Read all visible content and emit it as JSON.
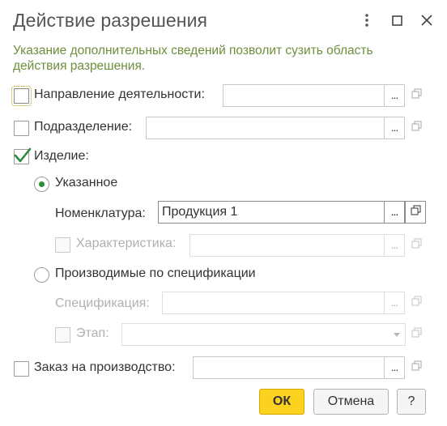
{
  "window": {
    "title": "Действие разрешения",
    "icons": {
      "more": "more-vertical-icon",
      "maximize": "maximize-icon",
      "close": "close-icon"
    }
  },
  "hint": "Указание дополнительных сведений позволит сузить область действия разрешения.",
  "fields": {
    "direction": {
      "label": "Направление деятельности:",
      "value": "",
      "checked": false
    },
    "division": {
      "label": "Подразделение:",
      "value": "",
      "checked": false
    },
    "product": {
      "label": "Изделие:",
      "checked": true
    },
    "specified": {
      "label": "Указанное",
      "selected": true
    },
    "nomenclature": {
      "label": "Номенклатура:",
      "value": "Продукция 1"
    },
    "characteristic": {
      "label": "Характеристика:",
      "value": "",
      "checked": false,
      "enabled": false
    },
    "produced_by_spec": {
      "label": "Производимые по спецификации",
      "selected": false
    },
    "specification": {
      "label": "Спецификация:",
      "value": "",
      "enabled": false
    },
    "stage": {
      "label": "Этап:",
      "value": "",
      "checked": false,
      "enabled": false
    },
    "production_order": {
      "label": "Заказ на производство:",
      "value": "",
      "checked": false
    }
  },
  "select_button_label": "...",
  "buttons": {
    "ok": "ОК",
    "cancel": "Отмена",
    "help": "?"
  },
  "colors": {
    "hint": "#6e8f3b",
    "check": "#2e8b3a",
    "ok_button": "#fbd21d"
  }
}
